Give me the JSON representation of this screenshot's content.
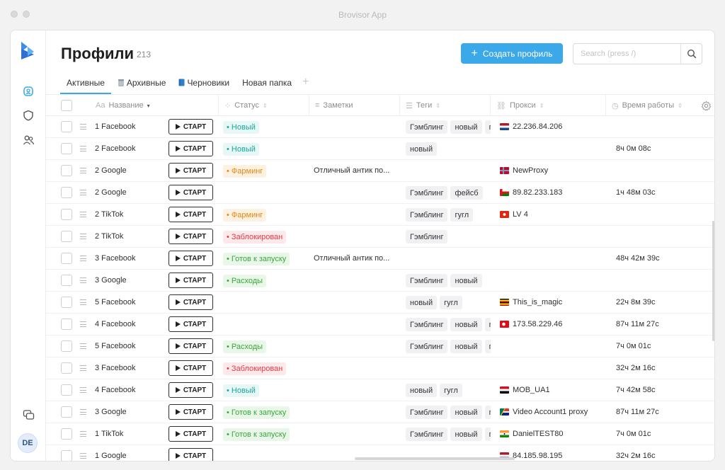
{
  "app": {
    "title": "Brovisor App"
  },
  "sidebar": {
    "logo_icon": "brovisor-logo",
    "items": [
      {
        "icon": "profiles-icon"
      },
      {
        "icon": "shield-icon"
      },
      {
        "icon": "users-icon"
      }
    ],
    "bottom_icon": "chat-icon",
    "avatar_initials": "DE"
  },
  "header": {
    "title": "Профили",
    "count": "213",
    "create_button": "Создать профиль",
    "search_placeholder": "Search (press /)"
  },
  "tabs": [
    {
      "label": "Активные",
      "active": true
    },
    {
      "label": "Архивные",
      "icon": "trash-icon"
    },
    {
      "label": "Черновики",
      "icon": "book-icon"
    },
    {
      "label": "Новая папка"
    }
  ],
  "columns": {
    "name": "Название",
    "status": "Статус",
    "notes": "Заметки",
    "tags": "Теги",
    "proxy": "Прокси",
    "worktime": "Время работы"
  },
  "start_label": "СТАРТ",
  "rows": [
    {
      "name": "1 Facebook",
      "status": "Новый",
      "status_type": "new",
      "note": "",
      "tags": [
        "Гэмблинг",
        "новый",
        "гугл"
      ],
      "proxy": "22.236.84.206",
      "flag": "nl",
      "time": ""
    },
    {
      "name": "2 Facebook",
      "status": "Новый",
      "status_type": "new",
      "note": "",
      "tags": [
        "новый"
      ],
      "proxy": "",
      "flag": "",
      "time": "8ч 0м 08с"
    },
    {
      "name": "2 Google",
      "status": "Фарминг",
      "status_type": "farm",
      "note": "Отличный антик по...",
      "tags": [],
      "proxy": "NewProxy",
      "flag": "no",
      "time": ""
    },
    {
      "name": "2 Google",
      "status": "",
      "status_type": "",
      "note": "",
      "tags": [
        "Гэмблинг",
        "фейсб"
      ],
      "proxy": "89.82.233.183",
      "flag": "om",
      "time": "1ч 48м 03с"
    },
    {
      "name": "2 TikTok",
      "status": "Фарминг",
      "status_type": "farm",
      "note": "",
      "tags": [
        "Гэмблинг",
        "гугл"
      ],
      "proxy": "LV 4",
      "flag": "hk",
      "time": ""
    },
    {
      "name": "2 TikTok",
      "status": "Заблокирован",
      "status_type": "blocked",
      "note": "",
      "tags": [
        "Гэмблинг"
      ],
      "proxy": "",
      "flag": "",
      "time": ""
    },
    {
      "name": "3 Facebook",
      "status": "Готов к запуску",
      "status_type": "ready",
      "note": "Отличный антик по...",
      "tags": [],
      "proxy": "",
      "flag": "",
      "time": "48ч 42м 39с"
    },
    {
      "name": "3 Google",
      "status": "Расходы",
      "status_type": "spend",
      "note": "",
      "tags": [
        "Гэмблинг",
        "новый"
      ],
      "proxy": "",
      "flag": "",
      "time": ""
    },
    {
      "name": "5 Facebook",
      "status": "",
      "status_type": "",
      "note": "",
      "tags": [
        "новый",
        "гугл"
      ],
      "proxy": "This_is_magic",
      "flag": "ug",
      "time": "22ч 8м 39с"
    },
    {
      "name": "4 Facebook",
      "status": "",
      "status_type": "",
      "note": "",
      "tags": [
        "Гэмблинг",
        "новый",
        "гугл"
      ],
      "proxy": "173.58.229.46",
      "flag": "tr",
      "time": "87ч 11м 27с"
    },
    {
      "name": "5 Facebook",
      "status": "Расходы",
      "status_type": "spend",
      "note": "",
      "tags": [
        "Гэмблинг",
        "новый",
        "гугл"
      ],
      "proxy": "",
      "flag": "",
      "time": "7ч 0м 01с"
    },
    {
      "name": "3 Facebook",
      "status": "Заблокирован",
      "status_type": "blocked",
      "note": "",
      "tags": [],
      "proxy": "",
      "flag": "",
      "time": "32ч 2м 16с"
    },
    {
      "name": "4 Facebook",
      "status": "Новый",
      "status_type": "new",
      "note": "",
      "tags": [
        "новый",
        "гугл"
      ],
      "proxy": "MOB_UA1",
      "flag": "eg",
      "time": "7ч 42м 58с"
    },
    {
      "name": "3 Google",
      "status": "Готов к запуску",
      "status_type": "ready",
      "note": "",
      "tags": [
        "Гэмблинг",
        "новый",
        "гугл"
      ],
      "proxy": "Video Account1 proxy",
      "flag": "za",
      "time": "87ч 11м 27с"
    },
    {
      "name": "1 TikTok",
      "status": "Готов к запуску",
      "status_type": "ready",
      "note": "",
      "tags": [
        "Гэмблинг",
        "новый",
        "гугл"
      ],
      "proxy": "DanielTEST80",
      "flag": "in",
      "time": "7ч 0м 01с"
    },
    {
      "name": "1 Google",
      "status": "",
      "status_type": "",
      "note": "",
      "tags": [],
      "proxy": "84.185.98.195",
      "flag": "nl",
      "time": "32ч 2м 16с"
    }
  ]
}
